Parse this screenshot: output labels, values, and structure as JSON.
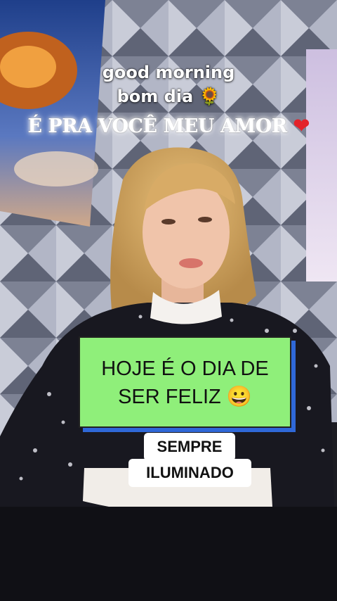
{
  "overlay": {
    "line1": "good morning",
    "line2": "bom dia 🌻",
    "line3_text": "É PRA VOCÊ MEU AMOR",
    "line3_heart": "❤",
    "card_line1": "HOJE É O DIA DE",
    "card_line2": "SER FELIZ 😀",
    "tag_line1": "SEMPRE",
    "tag_line2": "ILUMINADO"
  },
  "colors": {
    "card_green": "#8fef7a",
    "card_shadow_blue": "#2f68d8",
    "heart_red": "#e3232a"
  }
}
